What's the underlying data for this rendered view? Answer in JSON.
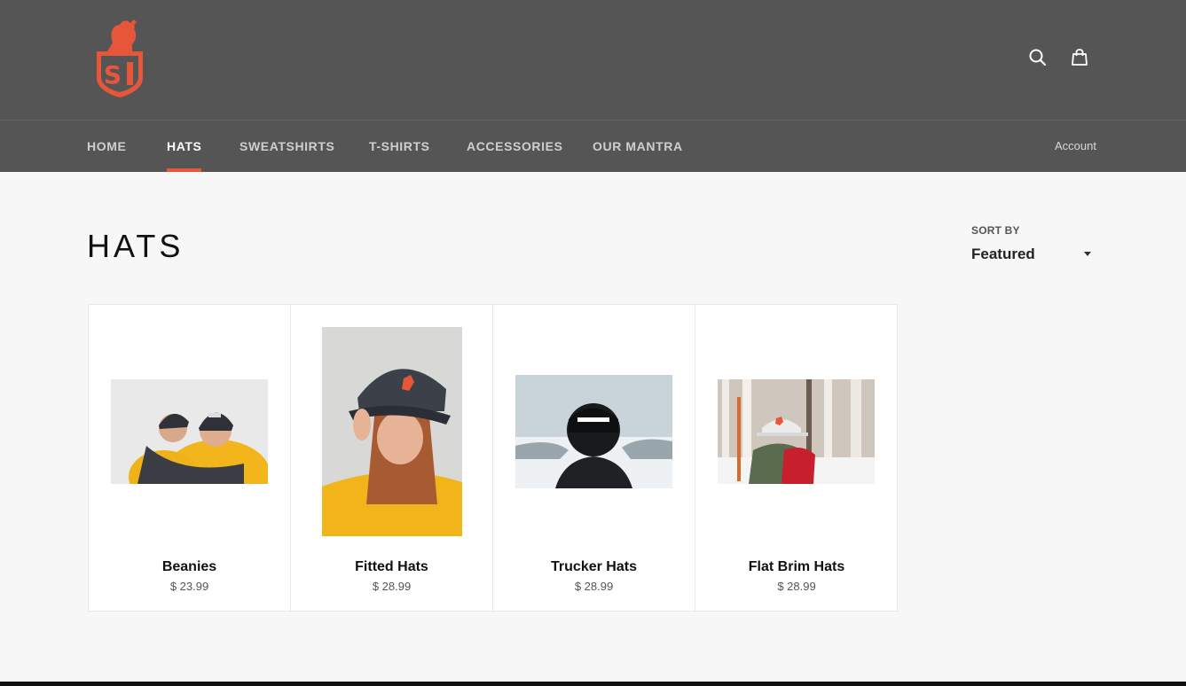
{
  "header": {
    "logo_text": "SB",
    "search_icon": "search-icon",
    "cart_icon": "shopping-bag-icon"
  },
  "nav": {
    "items": [
      {
        "label": "HOME",
        "active": false
      },
      {
        "label": "HATS",
        "active": true
      },
      {
        "label": "SWEATSHIRTS",
        "active": false
      },
      {
        "label": "T-SHIRTS",
        "active": false
      },
      {
        "label": "ACCESSORIES",
        "active": false
      },
      {
        "label": "OUR MANTRA",
        "active": false
      }
    ],
    "account_label": "Account"
  },
  "collection": {
    "title": "HATS",
    "sort_label": "SORT BY",
    "sort_value": "Featured"
  },
  "products": [
    {
      "name": "Beanies",
      "price": "$ 23.99"
    },
    {
      "name": "Fitted Hats",
      "price": "$ 28.99"
    },
    {
      "name": "Trucker Hats",
      "price": "$ 28.99"
    },
    {
      "name": "Flat Brim Hats",
      "price": "$ 28.99"
    }
  ],
  "colors": {
    "header_bg": "#555555",
    "accent": "#e8563a",
    "page_bg": "#f7f7f7"
  }
}
